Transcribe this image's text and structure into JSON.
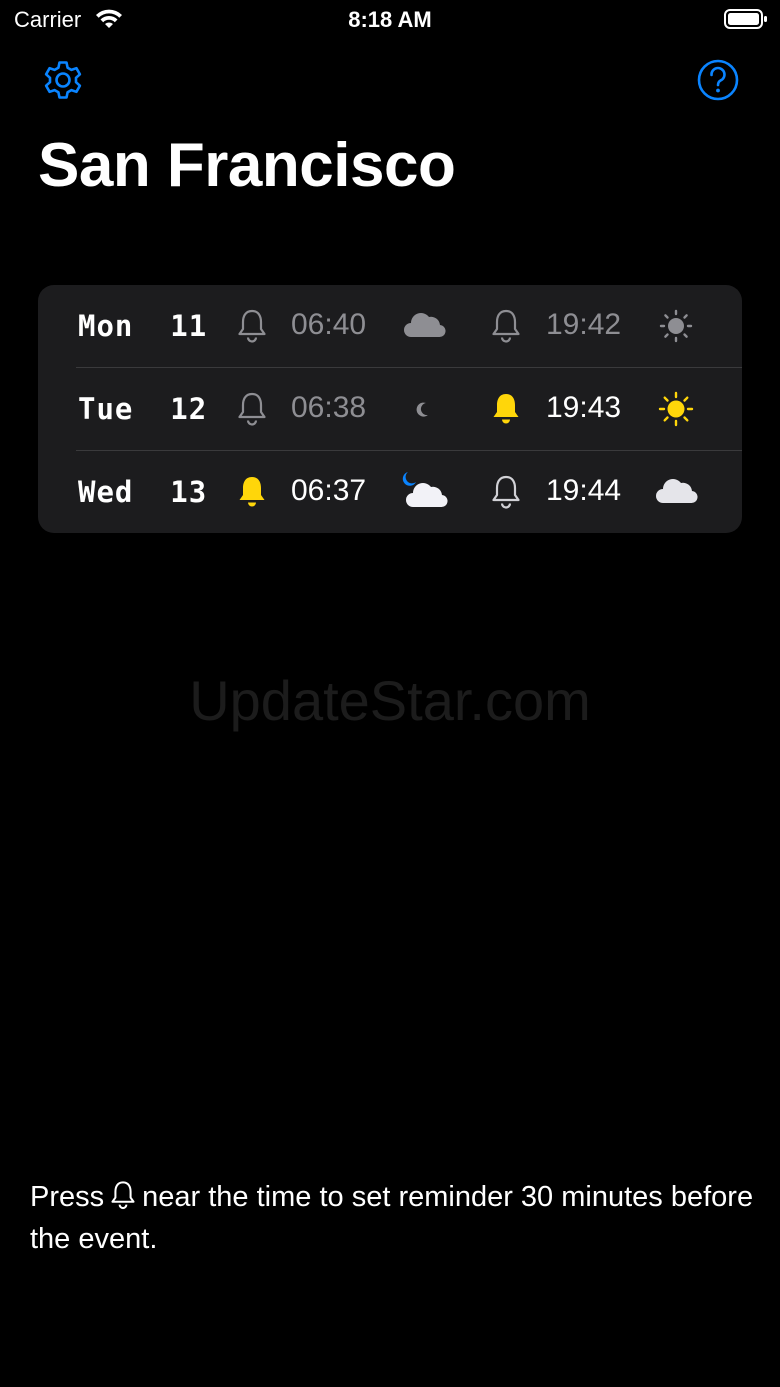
{
  "status_bar": {
    "carrier": "Carrier",
    "time": "8:18 AM"
  },
  "header": {
    "settings_icon": "gear-icon",
    "help_icon": "question-circle-icon",
    "title": "San Francisco"
  },
  "rows": [
    {
      "day": "Mon  11",
      "sunrise": {
        "time": "06:40",
        "reminder": false,
        "weather_icon": "cloud-icon"
      },
      "sunset": {
        "time": "19:42",
        "reminder": false,
        "weather_icon": "sun-dim-icon"
      }
    },
    {
      "day": "Tue  12",
      "sunrise": {
        "time": "06:38",
        "reminder": false,
        "weather_icon": "moon-icon"
      },
      "sunset": {
        "time": "19:43",
        "reminder": true,
        "weather_icon": "sun-icon"
      }
    },
    {
      "day": "Wed  13",
      "sunrise": {
        "time": "06:37",
        "reminder": true,
        "weather_icon": "moon-cloud-icon"
      },
      "sunset": {
        "time": "19:44",
        "reminder": false,
        "weather_icon": "cloud-icon"
      }
    }
  ],
  "watermark": "UpdateStar.com",
  "hint": {
    "before_icon": "Press",
    "after_icon": "near the time to set reminder 30 minutes before the event."
  },
  "colors": {
    "accent": "#0a84ff",
    "bell_active": "#ffd60a",
    "bell_inactive": "#8e8e93",
    "card": "#1c1c1e"
  }
}
